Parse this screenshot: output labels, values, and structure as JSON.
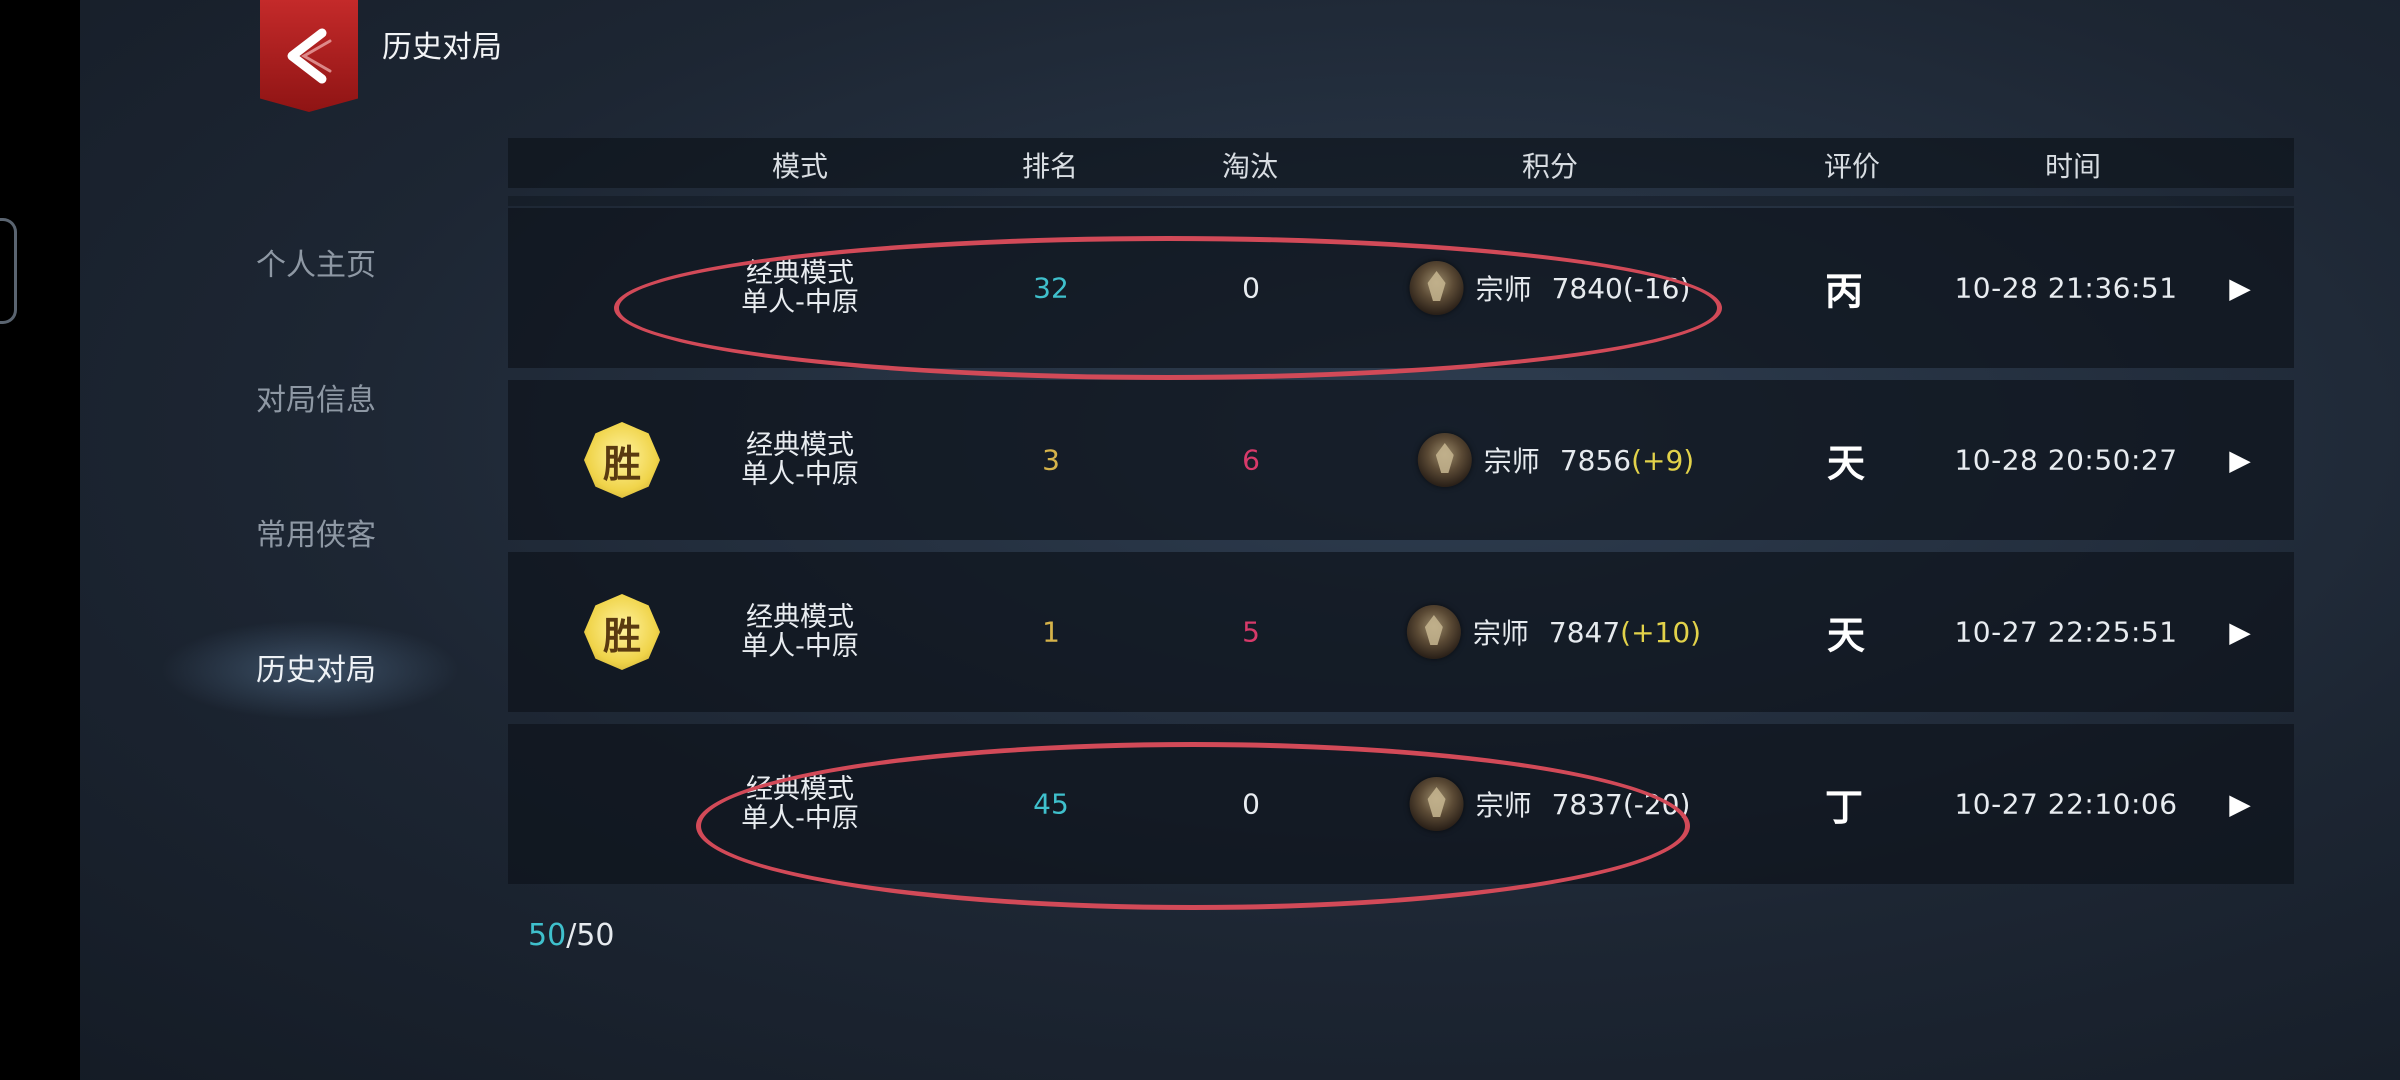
{
  "page": {
    "title": "历史对局"
  },
  "sidebar": {
    "items": [
      {
        "label": "个人主页",
        "active": false
      },
      {
        "label": "对局信息",
        "active": false
      },
      {
        "label": "常用侠客",
        "active": false
      },
      {
        "label": "历史对局",
        "active": true
      }
    ]
  },
  "table": {
    "headers": {
      "mode": "模式",
      "rank": "排名",
      "kills": "淘汰",
      "score": "积分",
      "grade": "评价",
      "time": "时间"
    },
    "rows": [
      {
        "win": false,
        "win_label": "",
        "mode_line1": "经典模式",
        "mode_line2": "单人-中原",
        "rank": "32",
        "kills": "0",
        "tier": "宗师",
        "score": "7840",
        "diff": "(-16)",
        "grade": "丙",
        "time": "10-28   21:36:51"
      },
      {
        "win": true,
        "win_label": "胜",
        "mode_line1": "经典模式",
        "mode_line2": "单人-中原",
        "rank": "3",
        "kills": "6",
        "tier": "宗师",
        "score": "7856",
        "diff": "(+9)",
        "grade": "天",
        "time": "10-28   20:50:27"
      },
      {
        "win": true,
        "win_label": "胜",
        "mode_line1": "经典模式",
        "mode_line2": "单人-中原",
        "rank": "1",
        "kills": "5",
        "tier": "宗师",
        "score": "7847",
        "diff": "(+10)",
        "grade": "天",
        "time": "10-27   22:25:51"
      },
      {
        "win": false,
        "win_label": "",
        "mode_line1": "经典模式",
        "mode_line2": "单人-中原",
        "rank": "45",
        "kills": "0",
        "tier": "宗师",
        "score": "7837",
        "diff": "(-20)",
        "grade": "丁",
        "time": "10-27   22:10:06"
      }
    ]
  },
  "pager": {
    "current": "50",
    "separator": "/",
    "total": "50"
  },
  "colors": {
    "accent_cyan": "#3fc0cc",
    "gold": "#d6b34a",
    "kill_red": "#d83a6a",
    "back_red": "#c42a2a",
    "annotation_red": "#d24a58"
  }
}
